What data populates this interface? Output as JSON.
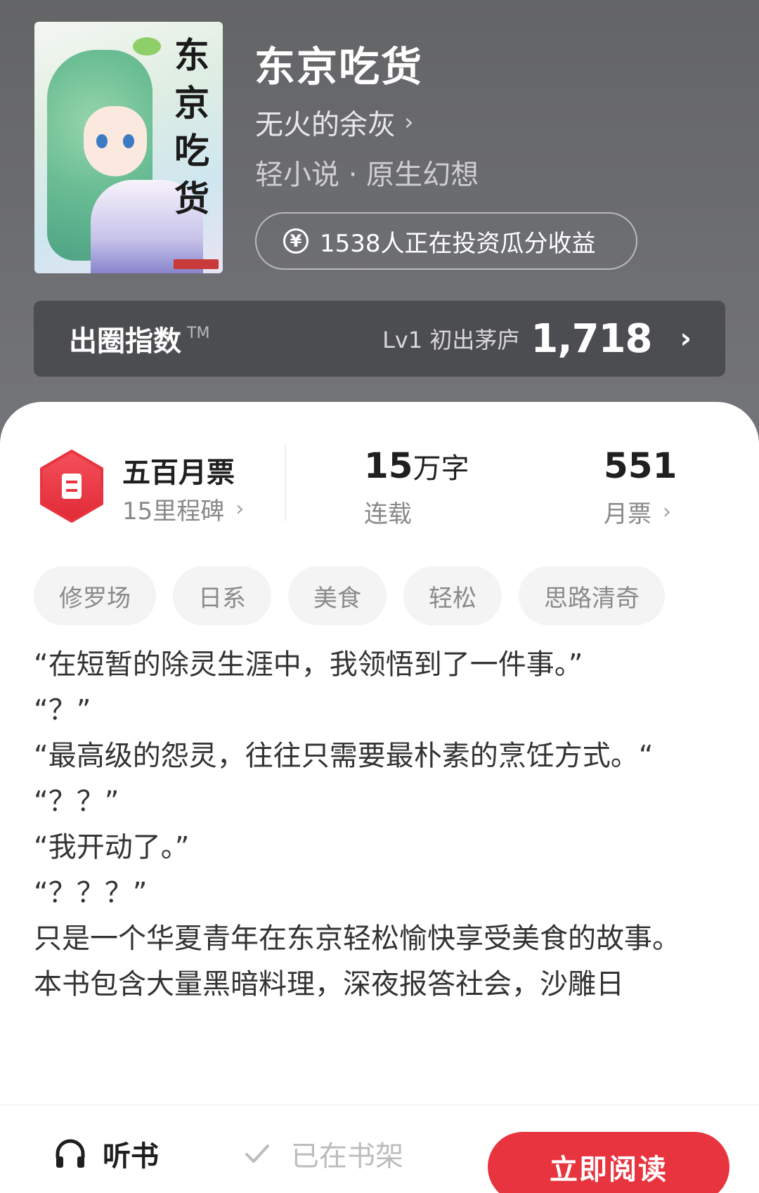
{
  "book": {
    "cover_title": "东京吃货",
    "title": "东京吃货",
    "author": "无火的余灰",
    "category": "轻小说 · 原生幻想",
    "invest_text": "1538人正在投资瓜分收益"
  },
  "index": {
    "label": "出圈指数",
    "tm": "TM",
    "level": "Lv1 初出茅庐",
    "value": "1,718"
  },
  "stats": {
    "monthly_ticket_title": "五百月票",
    "milestone": "15里程碑",
    "word_count_number": "15",
    "word_count_unit": "万字",
    "status": "连载",
    "tickets_value": "551",
    "tickets_label": "月票"
  },
  "tags": [
    "修罗场",
    "日系",
    "美食",
    "轻松",
    "思路清奇"
  ],
  "synopsis": "“在短暂的除灵生涯中，我领悟到了一件事。”\n“？”\n“最高级的怨灵，往往只需要最朴素的烹饪方式。“\n“？？”\n“我开动了。”\n“？？？”\n只是一个华夏青年在东京轻松愉快享受美食的故事。\n本书包含大量黑暗料理，深夜报答社会，沙雕日",
  "bottom": {
    "listen_label": "听书",
    "shelf_label": "已在书架",
    "read_label": "立即阅读"
  },
  "colors": {
    "accent": "#e8343e",
    "hero_bg": "#6b6c6e",
    "index_bar": "#4c4d50"
  },
  "icons": {
    "yen": "yen-circle-icon",
    "hex": "ticket-hexagon-icon",
    "headphone": "headphone-icon",
    "check": "check-icon"
  }
}
